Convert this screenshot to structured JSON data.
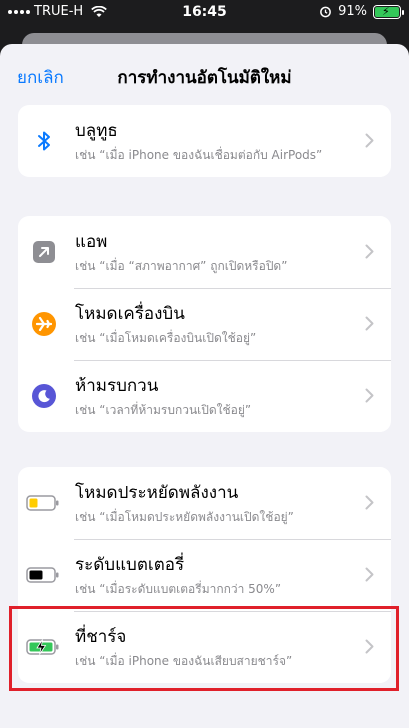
{
  "status_bar": {
    "carrier": "TRUE-H",
    "time": "16:45",
    "battery_percent": "91%"
  },
  "nav": {
    "cancel_label": "ยกเลิก",
    "title": "การทำงานอัตโนมัติใหม่"
  },
  "groups": [
    {
      "items": [
        {
          "title": "บลูทูธ",
          "subtitle": "เช่น “เมื่อ iPhone ของฉันเชื่อมต่อกับ AirPods”",
          "icon": "bluetooth-icon"
        }
      ]
    },
    {
      "items": [
        {
          "title": "แอพ",
          "subtitle": "เช่น “เมื่อ “สภาพอากาศ” ถูกเปิดหรือปิด”",
          "icon": "app-arrow-icon"
        },
        {
          "title": "โหมดเครื่องบิน",
          "subtitle": "เช่น “เมื่อโหมดเครื่องบินเปิดใช้อยู่”",
          "icon": "airplane-icon"
        },
        {
          "title": "ห้ามรบกวน",
          "subtitle": "เช่น “เวลาที่ห้ามรบกวนเปิดใช้อยู่”",
          "icon": "moon-icon"
        }
      ]
    },
    {
      "items": [
        {
          "title": "โหมดประหยัดพลังงาน",
          "subtitle": "เช่น “เมื่อโหมดประหยัดพลังงานเปิดใช้อยู่”",
          "icon": "low-power-battery-icon"
        },
        {
          "title": "ระดับแบตเตอรี่",
          "subtitle": "เช่น “เมื่อระดับแบตเตอรี่มากกว่า 50%”",
          "icon": "battery-level-icon"
        },
        {
          "title": "ที่ชาร์จ",
          "subtitle": "เช่น “เมื่อ iPhone ของฉันเสียบสายชาร์จ”",
          "icon": "charger-icon"
        }
      ]
    }
  ],
  "colors": {
    "accent": "#0a7aff",
    "highlight_border": "#e0202a",
    "airplane": "#ff9500",
    "moon": "#5856d6",
    "low_power": "#ffcc00",
    "charging": "#34c759"
  }
}
